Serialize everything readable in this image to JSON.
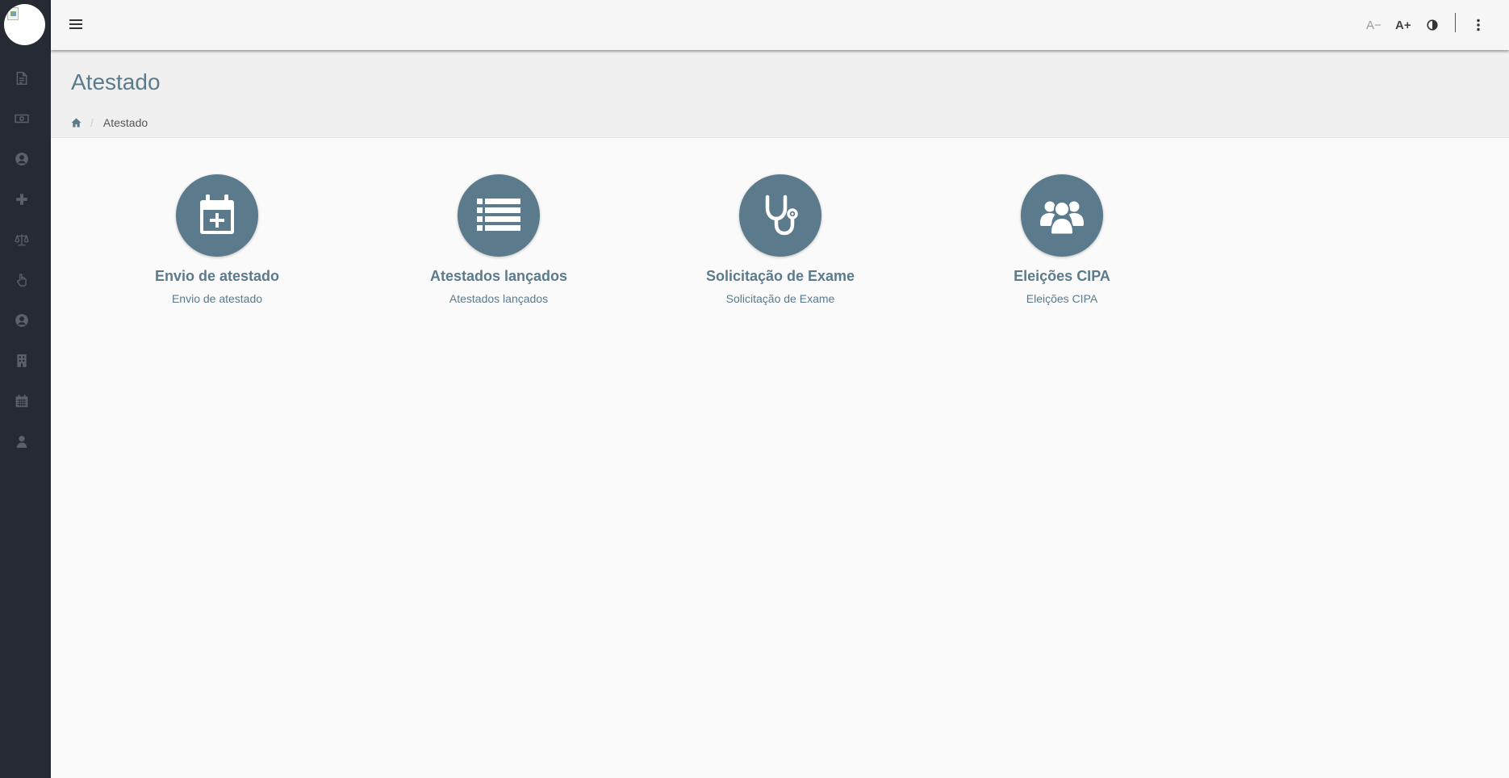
{
  "page": {
    "title": "Atestado"
  },
  "breadcrumb": {
    "home_icon": "home-icon",
    "current": "Atestado"
  },
  "toolbar": {
    "font_decrease": "A−",
    "font_increase": "A+",
    "contrast_icon": "contrast-icon",
    "more_icon": "more-vertical-icon"
  },
  "sidebar": {
    "items": [
      {
        "icon": "document-icon"
      },
      {
        "icon": "money-icon"
      },
      {
        "icon": "user-circle-icon"
      },
      {
        "icon": "plus-icon"
      },
      {
        "icon": "balance-scale-icon"
      },
      {
        "icon": "hand-pointer-icon"
      },
      {
        "icon": "user-circle-icon"
      },
      {
        "icon": "building-icon"
      },
      {
        "icon": "calendar-icon"
      },
      {
        "icon": "user-icon"
      }
    ]
  },
  "cards": [
    {
      "icon": "calendar-plus-icon",
      "title": "Envio de atestado",
      "subtitle": "Envio de atestado"
    },
    {
      "icon": "list-icon",
      "title": "Atestados lançados",
      "subtitle": "Atestados lançados"
    },
    {
      "icon": "stethoscope-icon",
      "title": "Solicitação de Exame",
      "subtitle": "Solicitação de Exame"
    },
    {
      "icon": "users-icon",
      "title": "Eleições CIPA",
      "subtitle": "Eleições CIPA"
    }
  ],
  "colors": {
    "sidebar_bg": "#252a33",
    "accent": "#5b7a8c",
    "topbar_bg": "#f6f6f6",
    "header_bg": "#f0f0f0",
    "content_bg": "#fafafa",
    "sidebar_icon": "#5b616b"
  }
}
